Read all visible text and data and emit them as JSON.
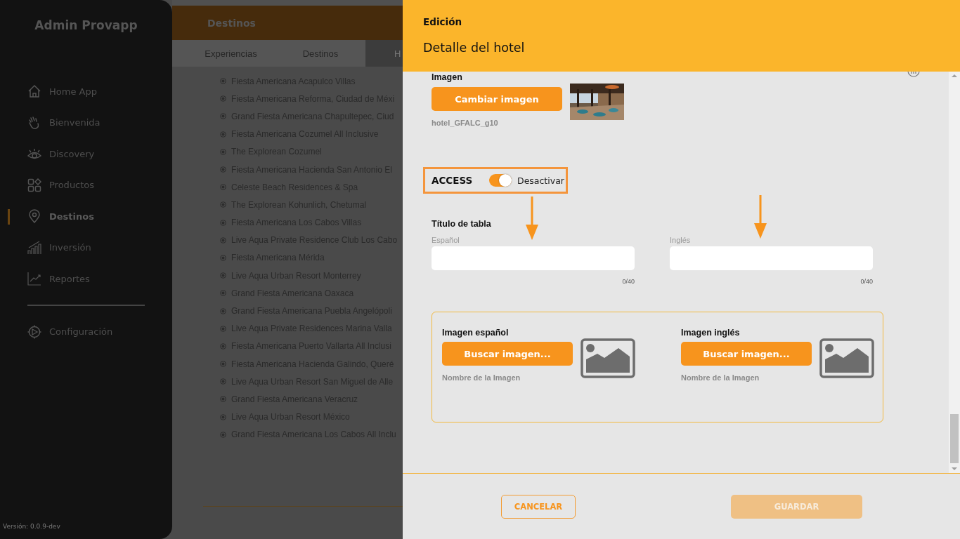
{
  "sidebar": {
    "title": "Admin Provapp",
    "items": [
      {
        "label": "Home App",
        "selected": false
      },
      {
        "label": "Bienvenida",
        "selected": false
      },
      {
        "label": "Discovery",
        "selected": false
      },
      {
        "label": "Productos",
        "selected": false
      },
      {
        "label": "Destinos",
        "selected": true
      },
      {
        "label": "Inversión",
        "selected": false
      },
      {
        "label": "Reportes",
        "selected": false
      }
    ],
    "footer_items": [
      {
        "label": "Configuración",
        "selected": false
      }
    ],
    "version": "Versión: 0.0.9-dev"
  },
  "page": {
    "title": "Destinos",
    "tabs": [
      {
        "label": "Experiencias",
        "selected": false
      },
      {
        "label": "Destinos",
        "selected": false
      },
      {
        "label": "H",
        "selected": true
      }
    ],
    "hotels": [
      "Fiesta Americana Acapulco Villas",
      "Fiesta Americana Reforma, Ciudad de Méxi",
      "Grand Fiesta Americana Chapultepec, Ciud",
      "Fiesta Americana Cozumel All Inclusive",
      "The Explorean Cozumel",
      "Fiesta Americana Hacienda San Antonio El",
      "Celeste Beach Residences & Spa",
      "The Explorean Kohunlich, Chetumal",
      "Fiesta Americana Los Cabos Villas",
      "Live Aqua Private Residence Club Los Cabo",
      "Fiesta Americana Mérida",
      "Live Aqua Urban Resort Monterrey",
      "Grand Fiesta Americana Oaxaca",
      "Grand Fiesta Americana Puebla Angelópoli",
      "Live Aqua Private Residences Marina Valla",
      "Fiesta Americana Puerto Vallarta All Inclusi",
      "Fiesta Americana Hacienda Galindo, Queré",
      "Live Aqua Urban Resort San Miguel de Alle",
      "Grand Fiesta Americana Veracruz",
      "Live Aqua Urban Resort México",
      "Grand Fiesta Americana Los Cabos All Inclu"
    ]
  },
  "drawer": {
    "subtitle": "Edición",
    "title": "Detalle del hotel",
    "image": {
      "label": "Imagen",
      "button": "Cambiar imagen",
      "filename": "hotel_GFALC_g10"
    },
    "access": {
      "label": "ACCESS",
      "on": true,
      "state_label": "Desactivar"
    },
    "table_title": {
      "label": "Título de tabla",
      "fields": [
        {
          "label": "Español",
          "counter": "0/40"
        },
        {
          "label": "Inglés",
          "counter": "0/40"
        }
      ]
    },
    "images": [
      {
        "label": "Imagen español",
        "button": "Buscar imagen...",
        "filename": "Nombre de la Imagen"
      },
      {
        "label": "Imagen inglés",
        "button": "Buscar imagen...",
        "filename": "Nombre de la Imagen"
      }
    ],
    "cancel_button": "CANCELAR",
    "save_button": {
      "label": "GUARDAR",
      "disabled": true
    }
  }
}
